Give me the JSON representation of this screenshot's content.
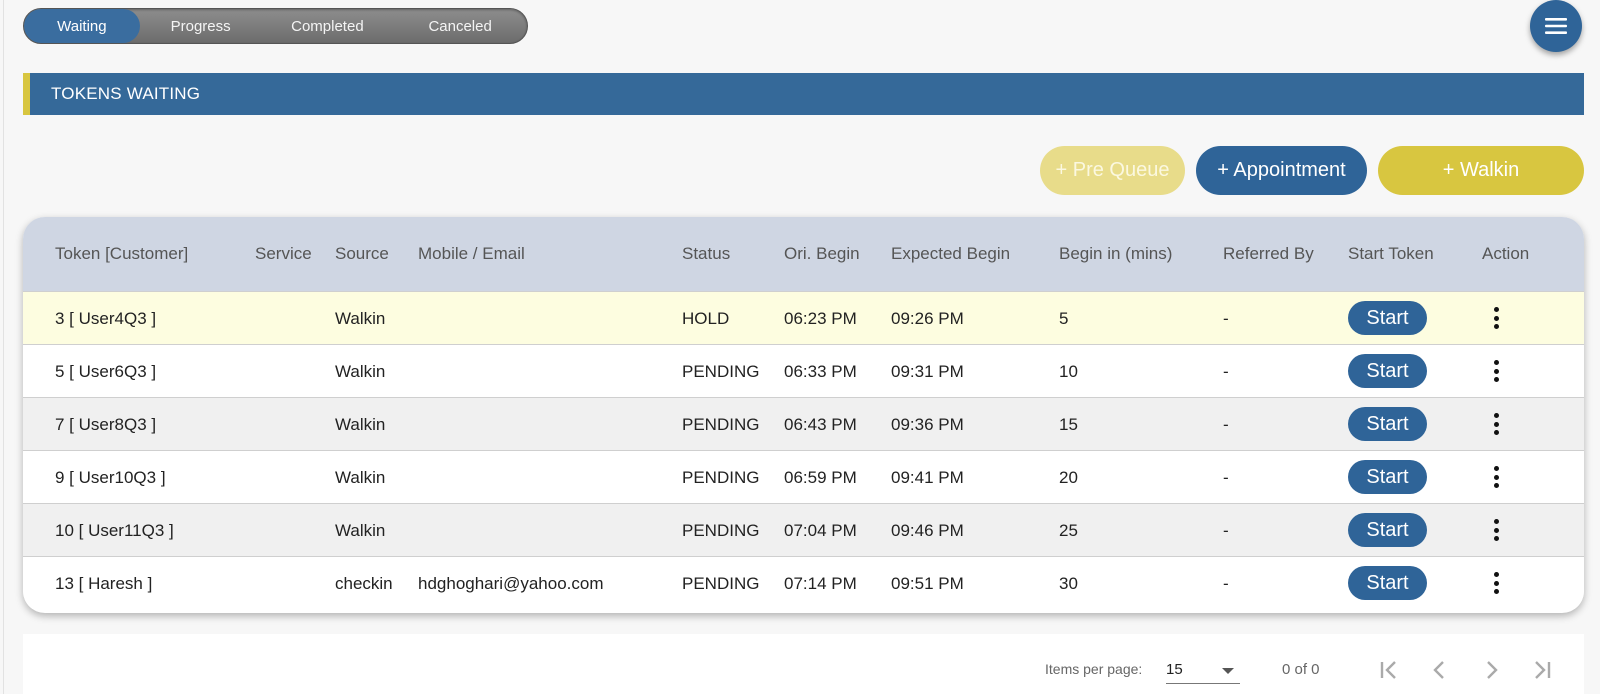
{
  "tabs": [
    {
      "label": "Waiting",
      "active": true
    },
    {
      "label": "Progress",
      "active": false
    },
    {
      "label": "Completed",
      "active": false
    },
    {
      "label": "Canceled",
      "active": false
    }
  ],
  "menu_icon": "hamburger-menu-icon",
  "section_title": "TOKENS WAITING",
  "actions": {
    "pre_queue": "+ Pre Queue",
    "appointment": "+ Appointment",
    "walkin": "+ Walkin"
  },
  "colors": {
    "primary": "#356999",
    "accent": "#d8c640",
    "header_bg": "#cfd6e3",
    "hold_row": "#fdfde0"
  },
  "table": {
    "headers": [
      "Token [Customer]",
      "Service",
      "Source",
      "Mobile / Email",
      "Status",
      "Ori. Begin",
      "Expected Begin",
      "Begin in (mins)",
      "Referred By",
      "Start Token",
      "Action"
    ],
    "start_label": "Start",
    "rows": [
      {
        "token": "3 [ User4Q3 ]",
        "service": "",
        "source": "Walkin",
        "contact": "",
        "status": "HOLD",
        "ori_begin": "06:23 PM",
        "expected_begin": "09:26 PM",
        "begin_in": "5",
        "referred_by": "-"
      },
      {
        "token": "5 [ User6Q3 ]",
        "service": "",
        "source": "Walkin",
        "contact": "",
        "status": "PENDING",
        "ori_begin": "06:33 PM",
        "expected_begin": "09:31 PM",
        "begin_in": "10",
        "referred_by": "-"
      },
      {
        "token": "7 [ User8Q3 ]",
        "service": "",
        "source": "Walkin",
        "contact": "",
        "status": "PENDING",
        "ori_begin": "06:43 PM",
        "expected_begin": "09:36 PM",
        "begin_in": "15",
        "referred_by": "-"
      },
      {
        "token": "9 [ User10Q3 ]",
        "service": "",
        "source": "Walkin",
        "contact": "",
        "status": "PENDING",
        "ori_begin": "06:59 PM",
        "expected_begin": "09:41 PM",
        "begin_in": "20",
        "referred_by": "-"
      },
      {
        "token": "10 [ User11Q3 ]",
        "service": "",
        "source": "Walkin",
        "contact": "",
        "status": "PENDING",
        "ori_begin": "07:04 PM",
        "expected_begin": "09:46 PM",
        "begin_in": "25",
        "referred_by": "-"
      },
      {
        "token": "13 [ Haresh ]",
        "service": "",
        "source": "checkin",
        "contact": "hdghoghari@yahoo.com",
        "status": "PENDING",
        "ori_begin": "07:14 PM",
        "expected_begin": "09:51 PM",
        "begin_in": "30",
        "referred_by": "-"
      }
    ]
  },
  "paginator": {
    "items_per_page_label": "Items per page:",
    "items_per_page": "15",
    "range": "0 of 0"
  }
}
